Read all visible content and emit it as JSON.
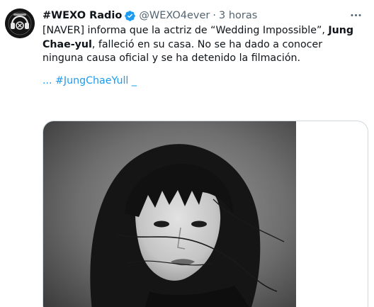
{
  "author": {
    "display_name": "#WEXO Radio",
    "handle": "@WEXO4ever",
    "separator": "·",
    "timestamp": "3 horas",
    "verified": true,
    "avatar_icon": "wexo-radio-logo"
  },
  "tweet": {
    "text_part1": "[NAVER] informa que la actriz de “Wedding Impossible”, ",
    "text_bold": "Jung Chae-yul",
    "text_part2": ", falleció en su casa. No se ha dado a conocer ninguna causa oficial y se ha detenido la filmación.",
    "hashtag_prefix": "... ",
    "hashtag": "#JungChaeYull",
    "hashtag_suffix": " _"
  },
  "media": {
    "description_icon": "portrait-photo"
  },
  "colors": {
    "accent": "#1d9bf0",
    "secondary_text": "#536471",
    "primary_text": "#0f1419",
    "border": "#cfd9de"
  }
}
